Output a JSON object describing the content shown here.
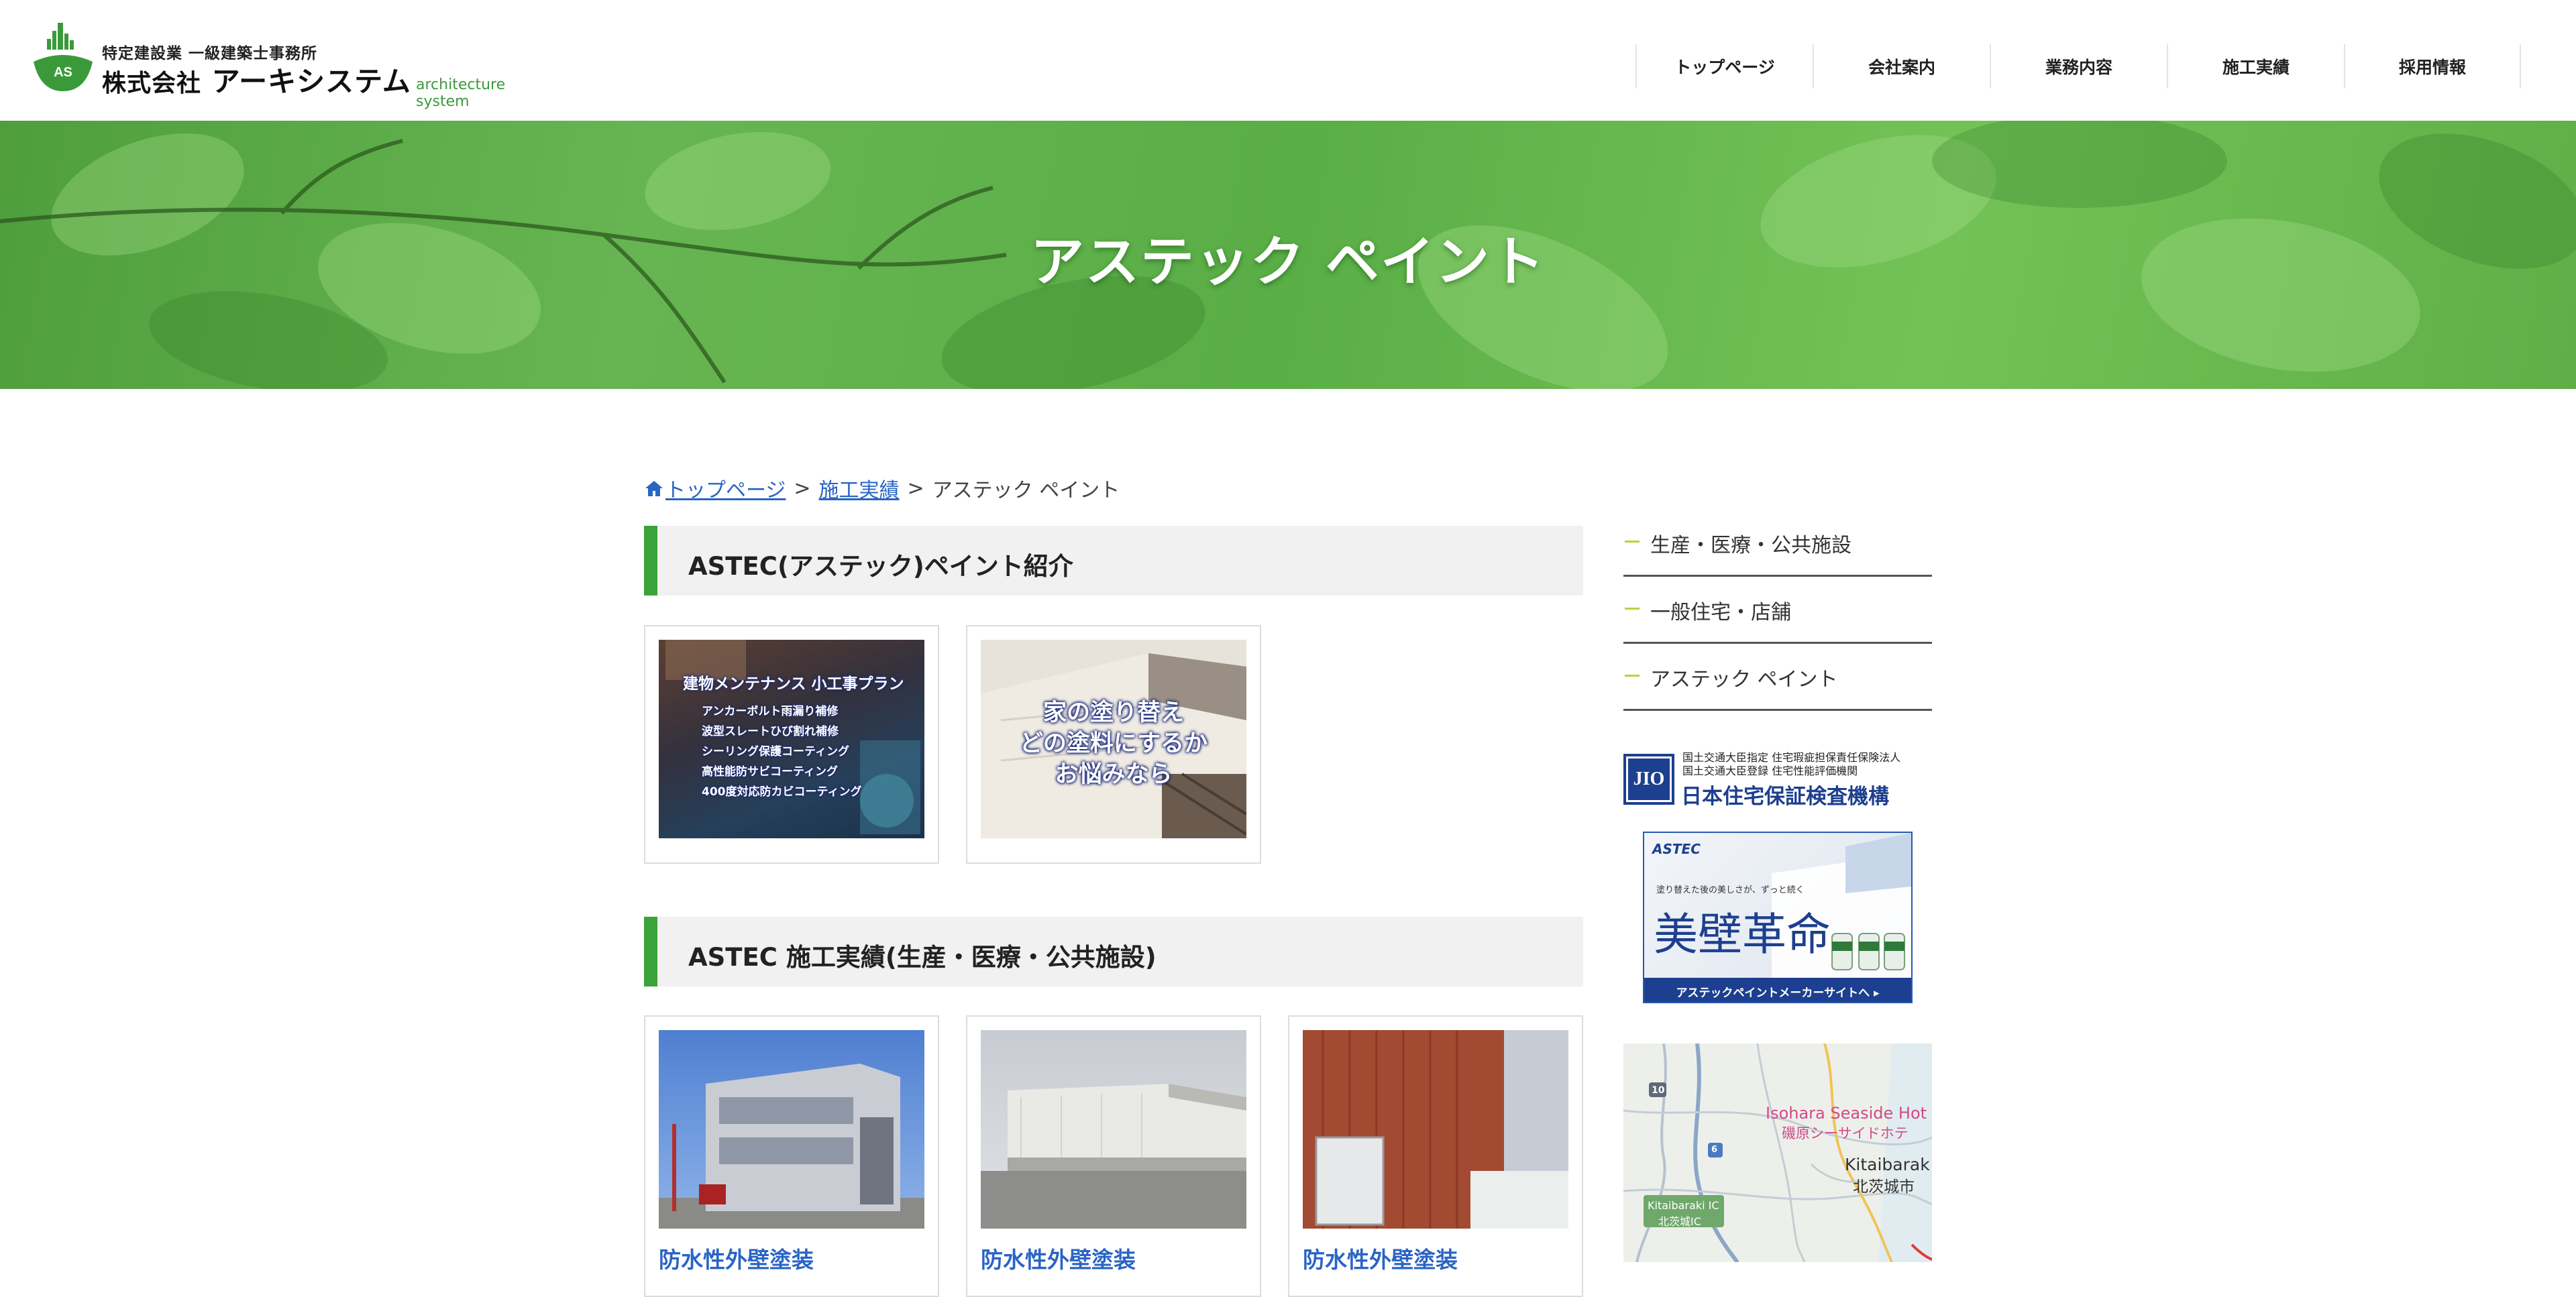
{
  "header": {
    "logo_sub": "特定建設業 一級建築士事務所",
    "logo_name_prefix": "株式会社",
    "logo_name": "アーキシステム",
    "logo_en": "architecture system",
    "logo_mark_text": "AS",
    "nav": [
      "トップページ",
      "会社案内",
      "業務内容",
      "施工実績",
      "採用情報"
    ]
  },
  "hero": {
    "title": "アステック ペイント"
  },
  "breadcrumb": {
    "home": "トップページ",
    "sep": ">",
    "mid": "施工実績",
    "current": "アステック ペイント"
  },
  "section1": {
    "title": "ASTEC(アステック)ペイント紹介",
    "cards": [
      {
        "heading": "建物メンテナンス 小工事プラン",
        "lines": [
          "アンカーボルト雨漏り補修",
          "波型スレートひび割れ補修",
          "シーリング保護コーティング",
          "高性能防サビコーティング",
          "400度対応防カビコーティング"
        ]
      },
      {
        "lines": [
          "家の塗り替え",
          "どの塗料にするか",
          "お悩みなら"
        ]
      }
    ]
  },
  "section2": {
    "title": "ASTEC 施工実績(生産・医療・公共施設)",
    "cards": [
      {
        "caption": "防水性外壁塗装"
      },
      {
        "caption": "防水性外壁塗装"
      },
      {
        "caption": "防水性外壁塗装"
      }
    ]
  },
  "sidebar": {
    "menu": [
      "生産・医療・公共施設",
      "一般住宅・店舗",
      "アステック ペイント"
    ],
    "jio": {
      "logo": "JIO",
      "line1": "国土交通大臣指定 住宅瑕疵担保責任保険法人",
      "line2": "国土交通大臣登録 住宅性能評価機関",
      "name": "日本住宅保証検査機構"
    },
    "astec_banner": {
      "brand": "ASTEC",
      "tagline": "塗り替えた後の美しさが、ずっと続く",
      "title": "美壁革命",
      "link": "アステックペイントメーカーサイトへ ▸"
    },
    "map": {
      "place_en": "Isohara Seaside Hot",
      "place_jp": "磯原シーサイドホテ",
      "city_en": "Kitaibarak",
      "city_jp": "北茨城市",
      "ic_en": "Kitaibaraki IC",
      "ic_jp": "北茨城IC",
      "route1": "10",
      "route2": "6"
    }
  },
  "colors": {
    "accent_green": "#3aa43a",
    "link_blue": "#2a64c5",
    "menu_dash": "#b9d23a"
  }
}
